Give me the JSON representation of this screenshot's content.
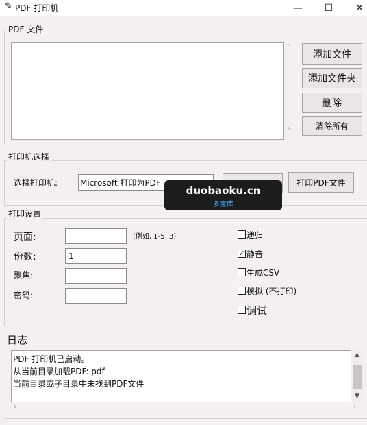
{
  "window": {
    "title": "PDF 打印机",
    "minimize": "—",
    "maximize": "☐",
    "close": "✕"
  },
  "pdf_files": {
    "group_title": "PDF 文件",
    "add_file": "添加文件",
    "add_folder": "添加文件夹",
    "delete": "删除",
    "clear_all": "清除所有"
  },
  "printer": {
    "group_title": "打印机选择",
    "select_label": "选择打印机:",
    "selected": "Microsoft 打印为PDF",
    "refresh": "刷新",
    "print_pdf": "打印PDF文件"
  },
  "watermark": {
    "main": "duobaoku.cn",
    "sub": "多宝库"
  },
  "settings": {
    "group_title": "打印设置",
    "pages_label": "页面:",
    "pages_value": "",
    "pages_hint": "(例如, 1-5, 3)",
    "copies_label": "份数:",
    "copies_value": "1",
    "focus_label": "聚焦:",
    "focus_value": "",
    "password_label": "密码:",
    "password_value": "",
    "checks": [
      {
        "label": "递归",
        "checked": false
      },
      {
        "label": "静音",
        "checked": true
      },
      {
        "label": "生成CSV",
        "checked": false
      },
      {
        "label": "模拟 (不打印)",
        "checked": false
      },
      {
        "label": "调试",
        "checked": false
      }
    ]
  },
  "log": {
    "title": "日志",
    "lines": [
      "PDF 打印机已启动。",
      "从当前目录加载PDF: pdf",
      "当前目录或子目录中未找到PDF文件"
    ]
  }
}
